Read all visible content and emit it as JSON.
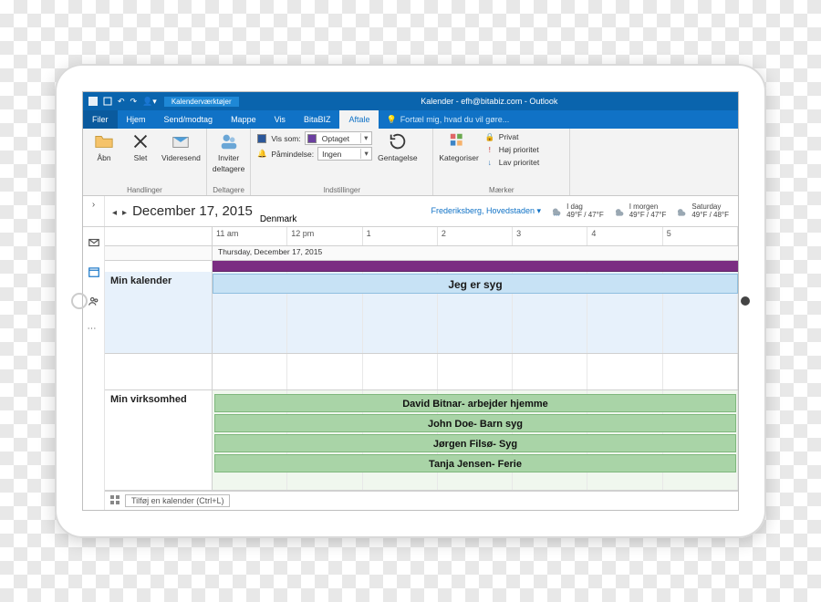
{
  "titlebar": {
    "context_tab": "Kalenderværktøjer",
    "window_title": "Kalender - efh@bitabiz.com - Outlook"
  },
  "tabs": {
    "filer": "Filer",
    "hjem": "Hjem",
    "sendmodtag": "Send/modtag",
    "mappe": "Mappe",
    "vis": "Vis",
    "bitabiz": "BitaBIZ",
    "aftale": "Aftale",
    "tellme": "Fortæl mig, hvad du vil gøre..."
  },
  "ribbon": {
    "handlinger": {
      "label": "Handlinger",
      "abn": "Åbn",
      "slet": "Slet",
      "videresend": "Videresend"
    },
    "deltagere": {
      "label": "Deltagere",
      "inviter1": "Inviter",
      "inviter2": "deltagere"
    },
    "indstillinger": {
      "label": "Indstillinger",
      "vis_som": "Vis som:",
      "vis_som_val": "Optaget",
      "pamindelse": "Påmindelse:",
      "pamindelse_val": "Ingen",
      "gentagelse": "Gentagelse"
    },
    "maerker": {
      "label": "Mærker",
      "kategoriser": "Kategoriser",
      "privat": "Privat",
      "hoj": "Høj prioritet",
      "lav": "Lav prioritet"
    }
  },
  "datebar": {
    "date": "December 17, 2015",
    "subloc": "Denmark",
    "location": "Frederiksberg, Hovedstaden",
    "w1_label": "I dag",
    "w1_temp": "49°F / 47°F",
    "w2_label": "I morgen",
    "w2_temp": "49°F / 47°F",
    "w3_label": "Saturday",
    "w3_temp": "49°F / 48°F"
  },
  "timeline": {
    "t0": "11 am",
    "t1": "12 pm",
    "t2": "1",
    "t3": "2",
    "t4": "3",
    "t5": "4",
    "t6": "5",
    "daylabel": "Thursday, December 17, 2015"
  },
  "rows": {
    "my_cal": "Min kalender",
    "my_cal_event": "Jeg er syg",
    "my_biz": "Min virksomhed",
    "biz0": "David Bitnar- arbejder hjemme",
    "biz1": "John Doe- Barn syg",
    "biz2": "Jørgen Filsø- Syg",
    "biz3": "Tanja Jensen- Ferie"
  },
  "footer": {
    "addcal": "Tilføj en kalender (Ctrl+L)"
  }
}
